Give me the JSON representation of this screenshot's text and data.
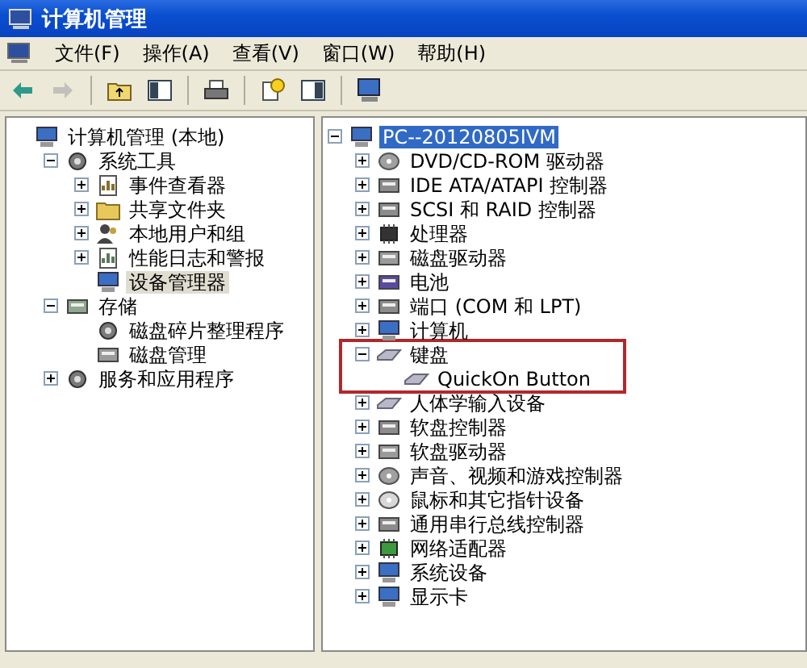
{
  "window": {
    "title": "计算机管理"
  },
  "menu": [
    "文件(F)",
    "操作(A)",
    "查看(V)",
    "窗口(W)",
    "帮助(H)"
  ],
  "toolbar": [
    {
      "kind": "back",
      "disabled": false
    },
    {
      "kind": "forward",
      "disabled": true
    },
    {
      "kind": "sep"
    },
    {
      "kind": "up",
      "disabled": false
    },
    {
      "kind": "tree",
      "disabled": false
    },
    {
      "kind": "sep"
    },
    {
      "kind": "print",
      "disabled": false
    },
    {
      "kind": "sep"
    },
    {
      "kind": "help",
      "disabled": false
    },
    {
      "kind": "panel",
      "disabled": false
    },
    {
      "kind": "sep"
    },
    {
      "kind": "computer",
      "disabled": false
    }
  ],
  "left_tree": {
    "focused": false,
    "root": {
      "label": "计算机管理 (本地)",
      "kind": "computer",
      "selected": false,
      "children": [
        {
          "label": "系统工具",
          "kind": "tools",
          "expanded": true,
          "selected": false,
          "highlighted": false,
          "children": [
            {
              "label": "事件查看器",
              "kind": "events",
              "expanded": false,
              "selected": false
            },
            {
              "label": "共享文件夹",
              "kind": "folder",
              "expanded": false,
              "selected": false
            },
            {
              "label": "本地用户和组",
              "kind": "users",
              "expanded": false,
              "selected": false
            },
            {
              "label": "性能日志和警报",
              "kind": "chart",
              "expanded": false,
              "selected": false
            },
            {
              "label": "设备管理器",
              "kind": "computer",
              "selected": true
            }
          ]
        },
        {
          "label": "存储",
          "kind": "storage",
          "expanded": true,
          "selected": false,
          "highlighted": false,
          "children": [
            {
              "label": "磁盘碎片整理程序",
              "kind": "tools",
              "selected": false
            },
            {
              "label": "磁盘管理",
              "kind": "drive",
              "selected": false
            }
          ]
        },
        {
          "label": "服务和应用程序",
          "kind": "tools",
          "expanded": false,
          "selected": false,
          "highlighted": false
        }
      ]
    }
  },
  "right_tree": {
    "focused": true,
    "root": {
      "label": "PC--20120805IVM",
      "kind": "computer",
      "expanded": true,
      "selected": true,
      "children": [
        {
          "label": "DVD/CD-ROM 驱动器",
          "kind": "disc",
          "expanded": false,
          "selected": false,
          "highlighted": false
        },
        {
          "label": "IDE ATA/ATAPI 控制器",
          "kind": "device",
          "expanded": false,
          "selected": false,
          "highlighted": false
        },
        {
          "label": "SCSI 和 RAID 控制器",
          "kind": "device",
          "expanded": false,
          "selected": false,
          "highlighted": false
        },
        {
          "label": "处理器",
          "kind": "chip",
          "expanded": false,
          "selected": false,
          "highlighted": false
        },
        {
          "label": "磁盘驱动器",
          "kind": "drive",
          "expanded": false,
          "selected": false,
          "highlighted": false
        },
        {
          "label": "电池",
          "kind": "battery",
          "expanded": false,
          "selected": false,
          "highlighted": false
        },
        {
          "label": "端口 (COM 和 LPT)",
          "kind": "device",
          "expanded": false,
          "selected": false,
          "highlighted": false
        },
        {
          "label": "计算机",
          "kind": "computer",
          "expanded": false,
          "selected": false,
          "highlighted": false
        },
        {
          "label": "键盘",
          "kind": "keyboard",
          "expanded": true,
          "selected": false,
          "highlighted": true,
          "children": [
            {
              "label": "QuickOn Button",
              "kind": "keyboard",
              "selected": false
            }
          ]
        },
        {
          "label": "人体学输入设备",
          "kind": "keyboard",
          "expanded": false,
          "selected": false,
          "highlighted": false
        },
        {
          "label": "软盘控制器",
          "kind": "device",
          "expanded": false,
          "selected": false,
          "highlighted": false
        },
        {
          "label": "软盘驱动器",
          "kind": "drive",
          "expanded": false,
          "selected": false,
          "highlighted": false
        },
        {
          "label": "声音、视频和游戏控制器",
          "kind": "disc",
          "expanded": false,
          "selected": false,
          "highlighted": false
        },
        {
          "label": "鼠标和其它指针设备",
          "kind": "mouse",
          "expanded": false,
          "selected": false,
          "highlighted": false
        },
        {
          "label": "通用串行总线控制器",
          "kind": "device",
          "expanded": false,
          "selected": false,
          "highlighted": false
        },
        {
          "label": "网络适配器",
          "kind": "network",
          "expanded": false,
          "selected": false,
          "highlighted": false
        },
        {
          "label": "系统设备",
          "kind": "computer",
          "expanded": false,
          "selected": false,
          "highlighted": false
        },
        {
          "label": "显示卡",
          "kind": "computer",
          "expanded": false,
          "selected": false,
          "highlighted": false
        }
      ]
    }
  }
}
